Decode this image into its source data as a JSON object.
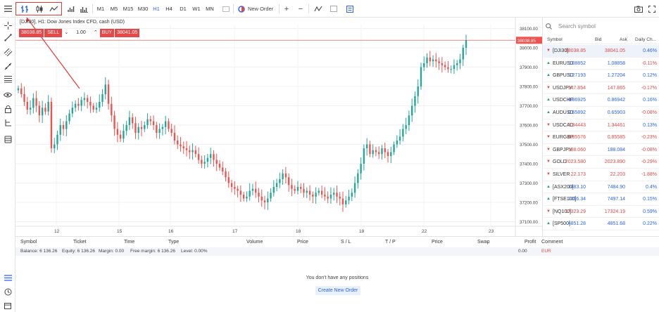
{
  "toolbar": {
    "timeframes": [
      "M1",
      "M5",
      "M15",
      "M30",
      "H1",
      "H4",
      "D1",
      "W1",
      "MN"
    ],
    "active_timeframe": "H1",
    "new_order_label": "New Order"
  },
  "chart": {
    "info": "[DJI30], H1: Dow Jones Index CFD, cash (USD)",
    "sell_price": "38038.85",
    "sell_label": "SELL",
    "qty_value": "1.00",
    "buy_label": "BUY",
    "buy_price": "38041.05",
    "price_label": "38038.85"
  },
  "chart_data": {
    "type": "candlestick",
    "y_axis_ticks": [
      38100,
      38000,
      37900,
      37800,
      37700,
      37600,
      37500,
      37400,
      37300,
      37200,
      37100
    ],
    "x_axis_ticks": [
      "12",
      "15",
      "16",
      "17",
      "18",
      "19",
      "22",
      "23"
    ],
    "current_price": 38038.85,
    "ylim": [
      37080,
      38120
    ],
    "series_closes": [
      37790,
      37760,
      37720,
      37680,
      37690,
      37740,
      37700,
      37650,
      37690,
      37670,
      37720,
      37480,
      37500,
      37550,
      37600,
      37580,
      37620,
      37660,
      37690,
      37710,
      37700,
      37730,
      37740,
      37720,
      37700,
      37680,
      37690,
      37720,
      37760,
      37810,
      37710,
      37650,
      37580,
      37550,
      37530,
      37570,
      37600,
      37640,
      37610,
      37560,
      37590,
      37580,
      37600,
      37630,
      37620,
      37600,
      37560,
      37580,
      37590,
      37620,
      37580,
      37560,
      37520,
      37500,
      37490,
      37480,
      37470,
      37460,
      37470,
      37450,
      37420,
      37400,
      37410,
      37430,
      37450,
      37420,
      37400,
      37380,
      37360,
      37330,
      37300,
      37280,
      37270,
      37260,
      37240,
      37220,
      37230,
      37260,
      37270,
      37250,
      37230,
      37210,
      37200,
      37220,
      37250,
      37280,
      37300,
      37320,
      37350,
      37330,
      37290,
      37270,
      37260,
      37280,
      37270,
      37250,
      37260,
      37240,
      37230,
      37250,
      37260,
      37240,
      37230,
      37220,
      37240,
      37250,
      37230,
      37220,
      37190,
      37210,
      37230,
      37250,
      37300,
      37350,
      37400,
      37480,
      37500,
      37450,
      37470,
      37460,
      37450,
      37480,
      37460,
      37440,
      37460,
      37500,
      37520,
      37540,
      37580,
      37600,
      37650,
      37700,
      37750,
      37800,
      37900,
      37920,
      37950,
      37930,
      37940,
      37930,
      37920,
      37910,
      37900,
      37890,
      37890,
      37910,
      37920,
      37940,
      38000,
      38040
    ]
  },
  "watchlist": {
    "search_placeholder": "Search symbol",
    "headers": [
      "Symbol",
      "Bid",
      "Ask",
      "Daily Ch..."
    ],
    "rows": [
      {
        "dir": "down",
        "symbol": "[DJI30]",
        "bid": "38038.85",
        "ask": "38041.05",
        "change": "0.46%",
        "bid_color": "red",
        "ask_color": "red",
        "change_color": "blue"
      },
      {
        "dir": "up",
        "symbol": "EURUSD",
        "bid": "1.08852",
        "ask": "1.08858",
        "change": "-0.11%",
        "bid_color": "blue",
        "ask_color": "blue",
        "change_color": "red"
      },
      {
        "dir": "up",
        "symbol": "GBPUSD",
        "bid": "1.27193",
        "ask": "1.27204",
        "change": "0.12%",
        "bid_color": "blue",
        "ask_color": "blue",
        "change_color": "blue"
      },
      {
        "dir": "down",
        "symbol": "USDJPY",
        "bid": "147.854",
        "ask": "147.865",
        "change": "-0.17%",
        "bid_color": "red",
        "ask_color": "red",
        "change_color": "red"
      },
      {
        "dir": "up",
        "symbol": "USDCHF",
        "bid": "0.86925",
        "ask": "0.86942",
        "change": "0.16%",
        "bid_color": "blue",
        "ask_color": "blue",
        "change_color": "blue"
      },
      {
        "dir": "up",
        "symbol": "AUDUSD",
        "bid": "0.65892",
        "ask": "0.65903",
        "change": "-0.08%",
        "bid_color": "blue",
        "ask_color": "blue",
        "change_color": "red"
      },
      {
        "dir": "down",
        "symbol": "USDCAD",
        "bid": "1.34443",
        "ask": "1.34461",
        "change": "0.13%",
        "bid_color": "red",
        "ask_color": "red",
        "change_color": "blue"
      },
      {
        "dir": "down",
        "symbol": "EURGBP",
        "bid": "0.85576",
        "ask": "0.85585",
        "change": "-0.23%",
        "bid_color": "red",
        "ask_color": "red",
        "change_color": "red"
      },
      {
        "dir": "down",
        "symbol": "GBPJPY",
        "bid": "188.060",
        "ask": "188.084",
        "change": "-0.08%",
        "bid_color": "red",
        "ask_color": "blue",
        "change_color": "red"
      },
      {
        "dir": "down",
        "symbol": "GOLD",
        "bid": "2023.580",
        "ask": "2023.890",
        "change": "-0.29%",
        "bid_color": "red",
        "ask_color": "red",
        "change_color": "red"
      },
      {
        "dir": "down",
        "symbol": "SILVER",
        "bid": "22.173",
        "ask": "22.203",
        "change": "-1.88%",
        "bid_color": "red",
        "ask_color": "red",
        "change_color": "red"
      },
      {
        "dir": "up",
        "symbol": "[ASX200]",
        "bid": "7483.10",
        "ask": "7484.90",
        "change": "0.4%",
        "bid_color": "blue",
        "ask_color": "blue",
        "change_color": "blue"
      },
      {
        "dir": "up",
        "symbol": "[FTSE100]",
        "bid": "7496.34",
        "ask": "7497.14",
        "change": "0.15%",
        "bid_color": "blue",
        "ask_color": "blue",
        "change_color": "blue"
      },
      {
        "dir": "down",
        "symbol": "[NQ100]",
        "bid": "17323.29",
        "ask": "17324.19",
        "change": "0.59%",
        "bid_color": "red",
        "ask_color": "red",
        "change_color": "blue"
      },
      {
        "dir": "up",
        "symbol": "[SP500]",
        "bid": "4851.28",
        "ask": "4851.68",
        "change": "0.22%",
        "bid_color": "blue",
        "ask_color": "blue",
        "change_color": "blue"
      }
    ]
  },
  "positions": {
    "headers": [
      "Symbol",
      "Ticket",
      "Time",
      "Type",
      "Volume",
      "Price",
      "S / L",
      "T / P",
      "Price",
      "Swap",
      "Profit",
      "Comment"
    ],
    "balance_label": "Balance: 6 136.26",
    "equity_label": "Equity: 6 136.26",
    "margin_label": "Margin: 0.00",
    "free_margin_label": "Free margin: 6 136.26",
    "level_label": "Level: 0.00%",
    "profit_total": "0.00",
    "currency": "EUR",
    "empty_message": "You don't have any positions",
    "create_button": "Create New Order"
  },
  "colors": {
    "up": "#26a69a",
    "down": "#ef5350",
    "accent": "#2962ff",
    "highlight": "#e53935"
  }
}
